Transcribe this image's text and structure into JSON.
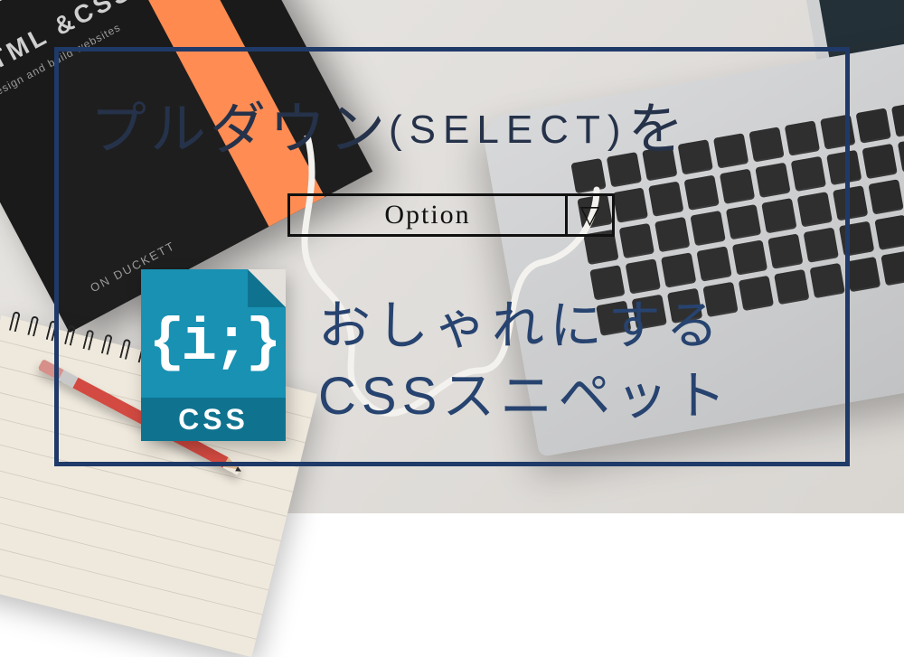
{
  "book": {
    "title": "HTML &CSS",
    "subtitle": "design and build websites",
    "author": "ON DUCKETT"
  },
  "frame": {
    "heading_main": "プルダウン",
    "heading_select": "(SELECT)",
    "heading_tail": "を"
  },
  "optionbox": {
    "label": "Option",
    "arrow": "▽"
  },
  "cssicon": {
    "braces": "{i;}",
    "band": "CSS"
  },
  "bottom": {
    "line1": "おしゃれにする",
    "line2": "CSSスニペット"
  }
}
